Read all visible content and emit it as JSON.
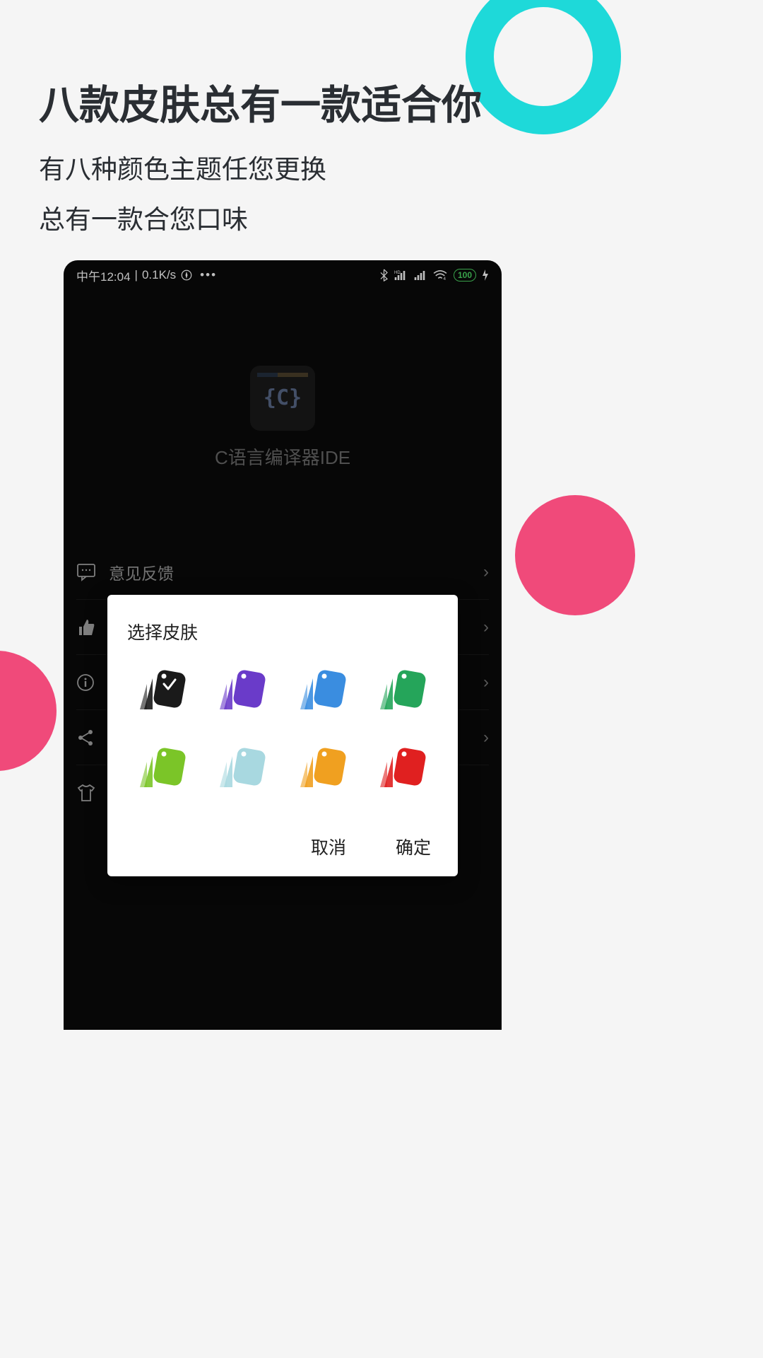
{
  "promo": {
    "headline": "八款皮肤总有一款适合你",
    "line1": "有八种颜色主题任您更换",
    "line2": "总有一款合您口味"
  },
  "status": {
    "time": "中午12:04",
    "speed": "0.1K/s",
    "battery": "100"
  },
  "app": {
    "iconText": "{C}",
    "name": "C语言编译器IDE"
  },
  "rows": [
    {
      "icon": "feedback-icon",
      "label": "意见反馈"
    },
    {
      "icon": "thumbs-icon",
      "label": ""
    },
    {
      "icon": "info-icon",
      "label": ""
    },
    {
      "icon": "share-icon",
      "label": ""
    },
    {
      "icon": "shirt-icon",
      "label": ""
    }
  ],
  "modal": {
    "title": "选择皮肤",
    "cancel": "取消",
    "confirm": "确定"
  },
  "skins": [
    {
      "name": "black",
      "color": "#1a1a1a",
      "selected": true
    },
    {
      "name": "purple",
      "color": "#6a3bc9",
      "selected": false
    },
    {
      "name": "blue",
      "color": "#3a8de0",
      "selected": false
    },
    {
      "name": "green",
      "color": "#25a55a",
      "selected": false
    },
    {
      "name": "lime",
      "color": "#7bc528",
      "selected": false
    },
    {
      "name": "lightblue",
      "color": "#a8d8e0",
      "selected": false
    },
    {
      "name": "orange",
      "color": "#f0a020",
      "selected": false
    },
    {
      "name": "red",
      "color": "#e02020",
      "selected": false
    }
  ]
}
